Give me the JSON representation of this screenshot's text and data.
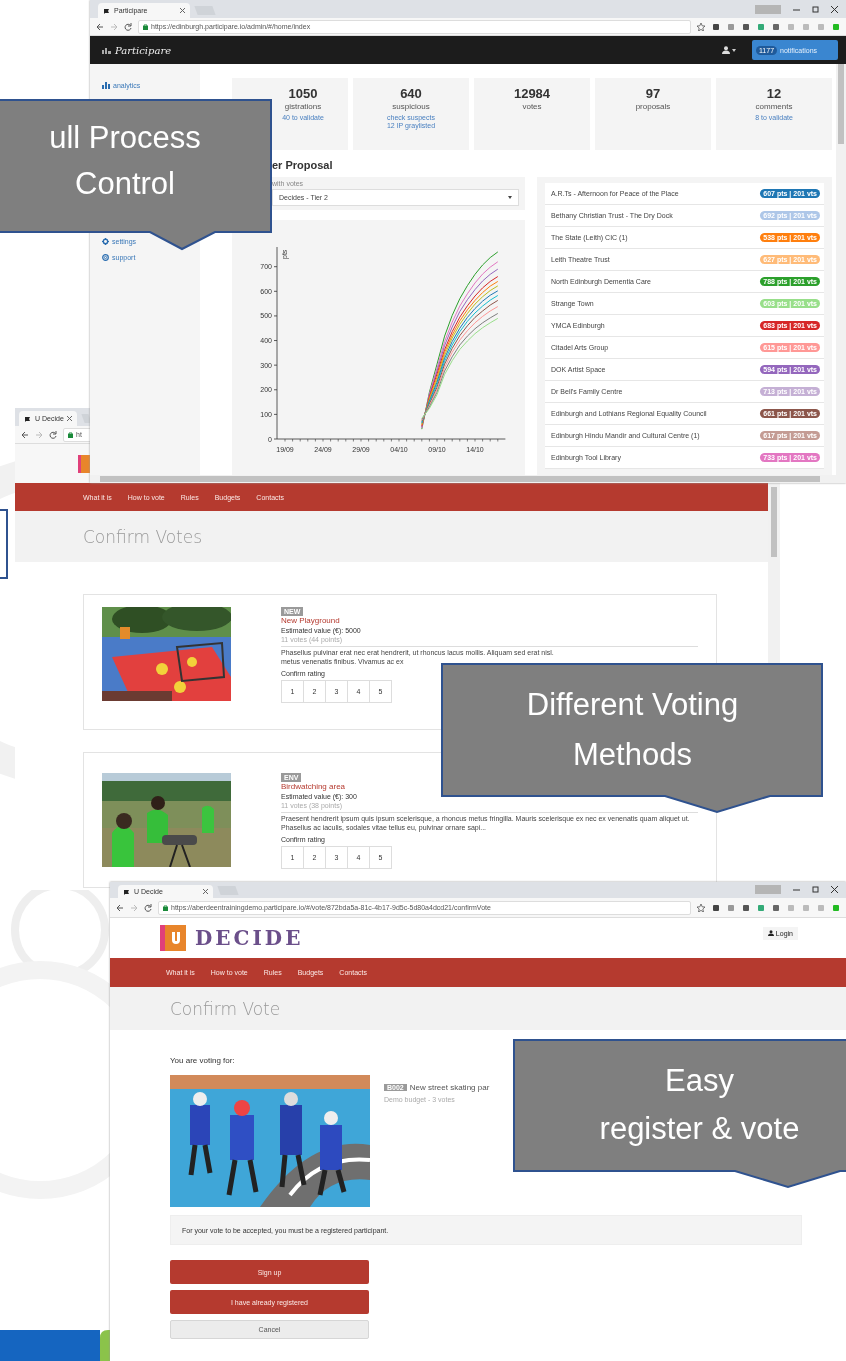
{
  "dashboard_window": {
    "tab": "Participare",
    "url": "https://edinburgh.participare.io/admin/#/home/index",
    "logo": "Participare",
    "notifications": {
      "count": "1177",
      "label": "notifications"
    },
    "sidebar": [
      {
        "label": "analytics"
      },
      {
        "label": "settings"
      },
      {
        "label": "support"
      }
    ],
    "stats": [
      {
        "value": "1050",
        "label": "gistrations",
        "links": [
          "40 to validate"
        ]
      },
      {
        "value": "640",
        "label": "suspicious",
        "links": [
          "check suspects",
          "12 IP graylisted"
        ]
      },
      {
        "value": "12984",
        "label": "votes"
      },
      {
        "value": "97",
        "label": "proposals"
      },
      {
        "value": "12",
        "label": "comments",
        "links": [
          "8 to validate"
        ]
      }
    ],
    "section_title": "er Proposal",
    "filter": {
      "label": "with votes",
      "value": "Decides - Tier 2"
    },
    "chart_data": {
      "type": "line",
      "ylabel": "pts",
      "categories": [
        "19/09",
        null,
        null,
        null,
        null,
        "24/09",
        null,
        null,
        null,
        null,
        "29/09",
        null,
        null,
        null,
        null,
        "04/10",
        null,
        null,
        null,
        null,
        "09/10",
        null,
        null,
        null,
        null,
        "14/10",
        null,
        null,
        null
      ],
      "ylim": [
        0,
        780
      ],
      "yticks": [
        0,
        100,
        200,
        300,
        400,
        500,
        600,
        700
      ],
      "series": [
        {
          "color": "#2ca02c",
          "values": [
            null,
            null,
            null,
            null,
            null,
            null,
            null,
            null,
            null,
            null,
            null,
            null,
            null,
            null,
            null,
            null,
            null,
            null,
            40,
            190,
            304,
            418,
            502,
            570,
            623,
            669,
            707,
            737,
            760
          ]
        },
        {
          "color": "#e377c2",
          "values": [
            null,
            null,
            null,
            null,
            null,
            null,
            null,
            null,
            null,
            null,
            null,
            null,
            null,
            null,
            null,
            null,
            null,
            null,
            44,
            184,
            288,
            396,
            475,
            540,
            590,
            634,
            670,
            698,
            720
          ]
        },
        {
          "color": "#9467bd",
          "values": [
            null,
            null,
            null,
            null,
            null,
            null,
            null,
            null,
            null,
            null,
            null,
            null,
            null,
            null,
            null,
            null,
            null,
            null,
            48,
            178,
            276,
            380,
            455,
            518,
            566,
            607,
            642,
            669,
            690
          ]
        },
        {
          "color": "#d62728",
          "values": [
            null,
            null,
            null,
            null,
            null,
            null,
            null,
            null,
            null,
            null,
            null,
            null,
            null,
            null,
            null,
            null,
            null,
            null,
            52,
            172,
            264,
            363,
            436,
            495,
            541,
            581,
            614,
            640,
            660
          ]
        },
        {
          "color": "#ff7f0e",
          "values": [
            null,
            null,
            null,
            null,
            null,
            null,
            null,
            null,
            null,
            null,
            null,
            null,
            null,
            null,
            null,
            null,
            null,
            null,
            56,
            166,
            252,
            352,
            422,
            480,
            525,
            563,
            595,
            621,
            640
          ]
        },
        {
          "color": "#bcbd22",
          "values": [
            null,
            null,
            null,
            null,
            null,
            null,
            null,
            null,
            null,
            null,
            null,
            null,
            null,
            null,
            null,
            null,
            null,
            null,
            60,
            160,
            240,
            340,
            410,
            466,
            510,
            548,
            578,
            603,
            622
          ]
        },
        {
          "color": "#1f77b4",
          "values": [
            null,
            null,
            null,
            null,
            null,
            null,
            null,
            null,
            null,
            null,
            null,
            null,
            null,
            null,
            null,
            null,
            null,
            null,
            64,
            154,
            230,
            328,
            396,
            450,
            494,
            530,
            560,
            584,
            602
          ]
        },
        {
          "color": "#17becf",
          "values": [
            null,
            null,
            null,
            null,
            null,
            null,
            null,
            null,
            null,
            null,
            null,
            null,
            null,
            null,
            null,
            null,
            null,
            null,
            68,
            148,
            220,
            316,
            382,
            436,
            478,
            512,
            540,
            564,
            583
          ]
        },
        {
          "color": "#8c564b",
          "values": [
            null,
            null,
            null,
            null,
            null,
            null,
            null,
            null,
            null,
            null,
            null,
            null,
            null,
            null,
            null,
            null,
            null,
            null,
            72,
            142,
            210,
            304,
            368,
            420,
            460,
            494,
            520,
            544,
            563
          ]
        },
        {
          "color": "#ff9896",
          "values": [
            null,
            null,
            null,
            null,
            null,
            null,
            null,
            null,
            null,
            null,
            null,
            null,
            null,
            null,
            null,
            null,
            null,
            null,
            76,
            136,
            200,
            290,
            352,
            402,
            440,
            472,
            498,
            520,
            538
          ]
        },
        {
          "color": "#7f7f7f",
          "values": [
            null,
            null,
            null,
            null,
            null,
            null,
            null,
            null,
            null,
            null,
            null,
            null,
            null,
            null,
            null,
            null,
            null,
            null,
            80,
            130,
            190,
            276,
            334,
            382,
            418,
            448,
            472,
            492,
            510
          ]
        },
        {
          "color": "#98df8a",
          "values": [
            null,
            null,
            null,
            null,
            null,
            null,
            null,
            null,
            null,
            null,
            null,
            null,
            null,
            null,
            null,
            null,
            null,
            null,
            84,
            124,
            180,
            262,
            318,
            364,
            398,
            428,
            452,
            472,
            490
          ]
        }
      ]
    },
    "proposals": [
      {
        "name": "A.R.Ts - Afternoon for Peace of the Place",
        "badge": "607 pts | 201 vts",
        "color": "#1f77b4"
      },
      {
        "name": "Bethany Christian Trust - The Dry Dock",
        "badge": "692 pts | 201 vts",
        "color": "#aec7e8"
      },
      {
        "name": "The State (Leith) CIC (1)",
        "badge": "538 pts | 201 vts",
        "color": "#ff7f0e"
      },
      {
        "name": "Leith Theatre Trust",
        "badge": "627 pts | 201 vts",
        "color": "#ffbb78"
      },
      {
        "name": "North Edinburgh Dementia Care",
        "badge": "788 pts | 201 vts",
        "color": "#2ca02c"
      },
      {
        "name": "Strange Town",
        "badge": "603 pts | 201 vts",
        "color": "#98df8a"
      },
      {
        "name": "YMCA Edinburgh",
        "badge": "683 pts | 201 vts",
        "color": "#d62728"
      },
      {
        "name": "Citadel Arts Group",
        "badge": "615 pts | 201 vts",
        "color": "#ff9896"
      },
      {
        "name": "DOK Artist Space",
        "badge": "594 pts | 201 vts",
        "color": "#9467bd"
      },
      {
        "name": "Dr Bell's Family Centre",
        "badge": "713 pts | 201 vts",
        "color": "#c5b0d5"
      },
      {
        "name": "Edinburgh and Lothians Regional Equality Council",
        "badge": "661 pts | 201 vts",
        "color": "#8c564b"
      },
      {
        "name": "Edinburgh Hindu Mandir and Cultural Centre (1)",
        "badge": "617 pts | 201 vts",
        "color": "#c49c94"
      },
      {
        "name": "Edinburgh Tool Library",
        "badge": "733 pts | 201 vts",
        "color": "#e377c2"
      }
    ]
  },
  "votes_window": {
    "tab": "U Decide",
    "url": "ht",
    "nav": [
      "What it is",
      "How to vote",
      "Rules",
      "Budgets",
      "Contacts"
    ],
    "title": "Confirm Votes",
    "projects": [
      {
        "tag": "NEW",
        "title": "New Playground",
        "value": "Estimated value (€): 5000",
        "votes": "11 votes (44 points)",
        "description": [
          "Phasellus pulvinar erat nec erat hendrerit, ut rhoncus lacus mollis. Aliquam sed erat nisl.",
          "metus venenatis finibus. Vivamus ac ex"
        ],
        "rating_label": "Confirm rating",
        "ratings": [
          "1",
          "2",
          "3",
          "4",
          "5"
        ]
      },
      {
        "tag": "ENV",
        "title": "Birdwatching area",
        "value": "Estimated value (€): 300",
        "votes": "11 votes (38 points)",
        "description": [
          "Praesent hendrerit ipsum quis ipsum scelerisque, a rhoncus metus fringilla. Mauris scelerisque ex nec ex venenatis quam aliquet ut. Phasellus ac iaculis, sodales vitae tellus eu, pulvinar ornare sapi..."
        ],
        "rating_label": "Confirm rating",
        "ratings": [
          "1",
          "2",
          "3",
          "4",
          "5"
        ]
      }
    ]
  },
  "vote_window": {
    "tab": "U Decide",
    "url": "https://aberdeentrainingdemo.participare.io/#/vote/872bda5a-81c-4b17-9d5c-5d80a4dcd21/confirmVote",
    "brand": "DECIDE",
    "login": "Login",
    "nav": [
      "What it is",
      "How to vote",
      "Rules",
      "Budgets",
      "Contacts"
    ],
    "title": "Confirm Vote",
    "intro": "You are voting for:",
    "project": {
      "tag": "B002",
      "title": "New street skating par",
      "meta": "Demo budget - 3 votes"
    },
    "notice": "For your vote to be accepted, you must be a registered participant.",
    "buttons": [
      {
        "label": "Sign up",
        "kind": "primary"
      },
      {
        "label": "I have already registered",
        "kind": "primary"
      },
      {
        "label": "Cancel",
        "kind": "secondary"
      }
    ]
  },
  "callouts": [
    {
      "lines": [
        "ull Process",
        "Control"
      ]
    },
    {
      "lines": [
        "Different Voting",
        "Methods"
      ]
    },
    {
      "lines": [
        "Easy",
        "register & vote"
      ]
    }
  ]
}
